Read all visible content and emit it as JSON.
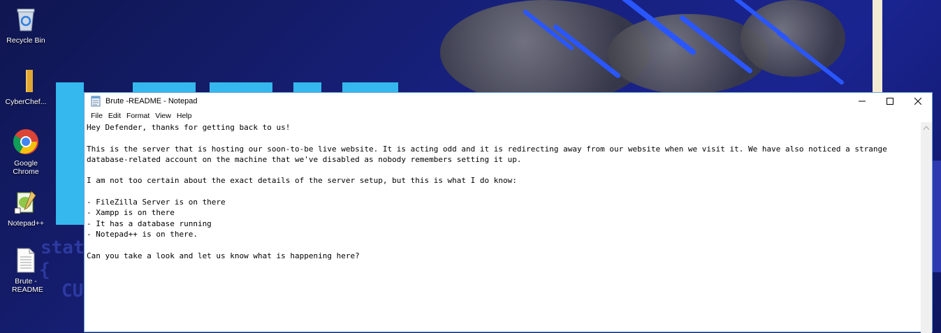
{
  "desktop": {
    "icons": [
      {
        "label": "Recycle Bin",
        "icon": "recycle-bin-icon"
      },
      {
        "label": "CyberChef...",
        "icon": "folder-icon"
      },
      {
        "label": "Google Chrome",
        "icon": "chrome-icon"
      },
      {
        "label": "Notepad++",
        "icon": "notepadpp-icon"
      },
      {
        "label": "Brute -README",
        "icon": "text-file-icon"
      }
    ],
    "wallpaper_code": [
      "stat",
      "{",
      "CU"
    ]
  },
  "window": {
    "title": "Brute -README - Notepad",
    "controls": {
      "minimize": "—",
      "maximize": "☐",
      "close": "✕"
    },
    "menu": [
      "File",
      "Edit",
      "Format",
      "View",
      "Help"
    ],
    "content_lines": [
      "Hey Defender, thanks for getting back to us!",
      "",
      "This is the server that is hosting our soon-to-be live website. It is acting odd and it is redirecting away from our website when we visit it. We have also noticed a strange",
      "database-related account on the machine that we've disabled as nobody remembers setting it up.",
      "",
      "I am not too certain about the exact details of the server setup, but this is what I do know:",
      "",
      "- FileZilla Server is on there",
      "- Xampp is on there",
      "- It has a database running",
      "- Notepad++ is on there.",
      "",
      "Can you take a look and let us know what is happening here?"
    ]
  },
  "colors": {
    "accent": "#35b8ee",
    "wallpaper_bg": "#17207a",
    "window_border": "#6aa0d8"
  }
}
